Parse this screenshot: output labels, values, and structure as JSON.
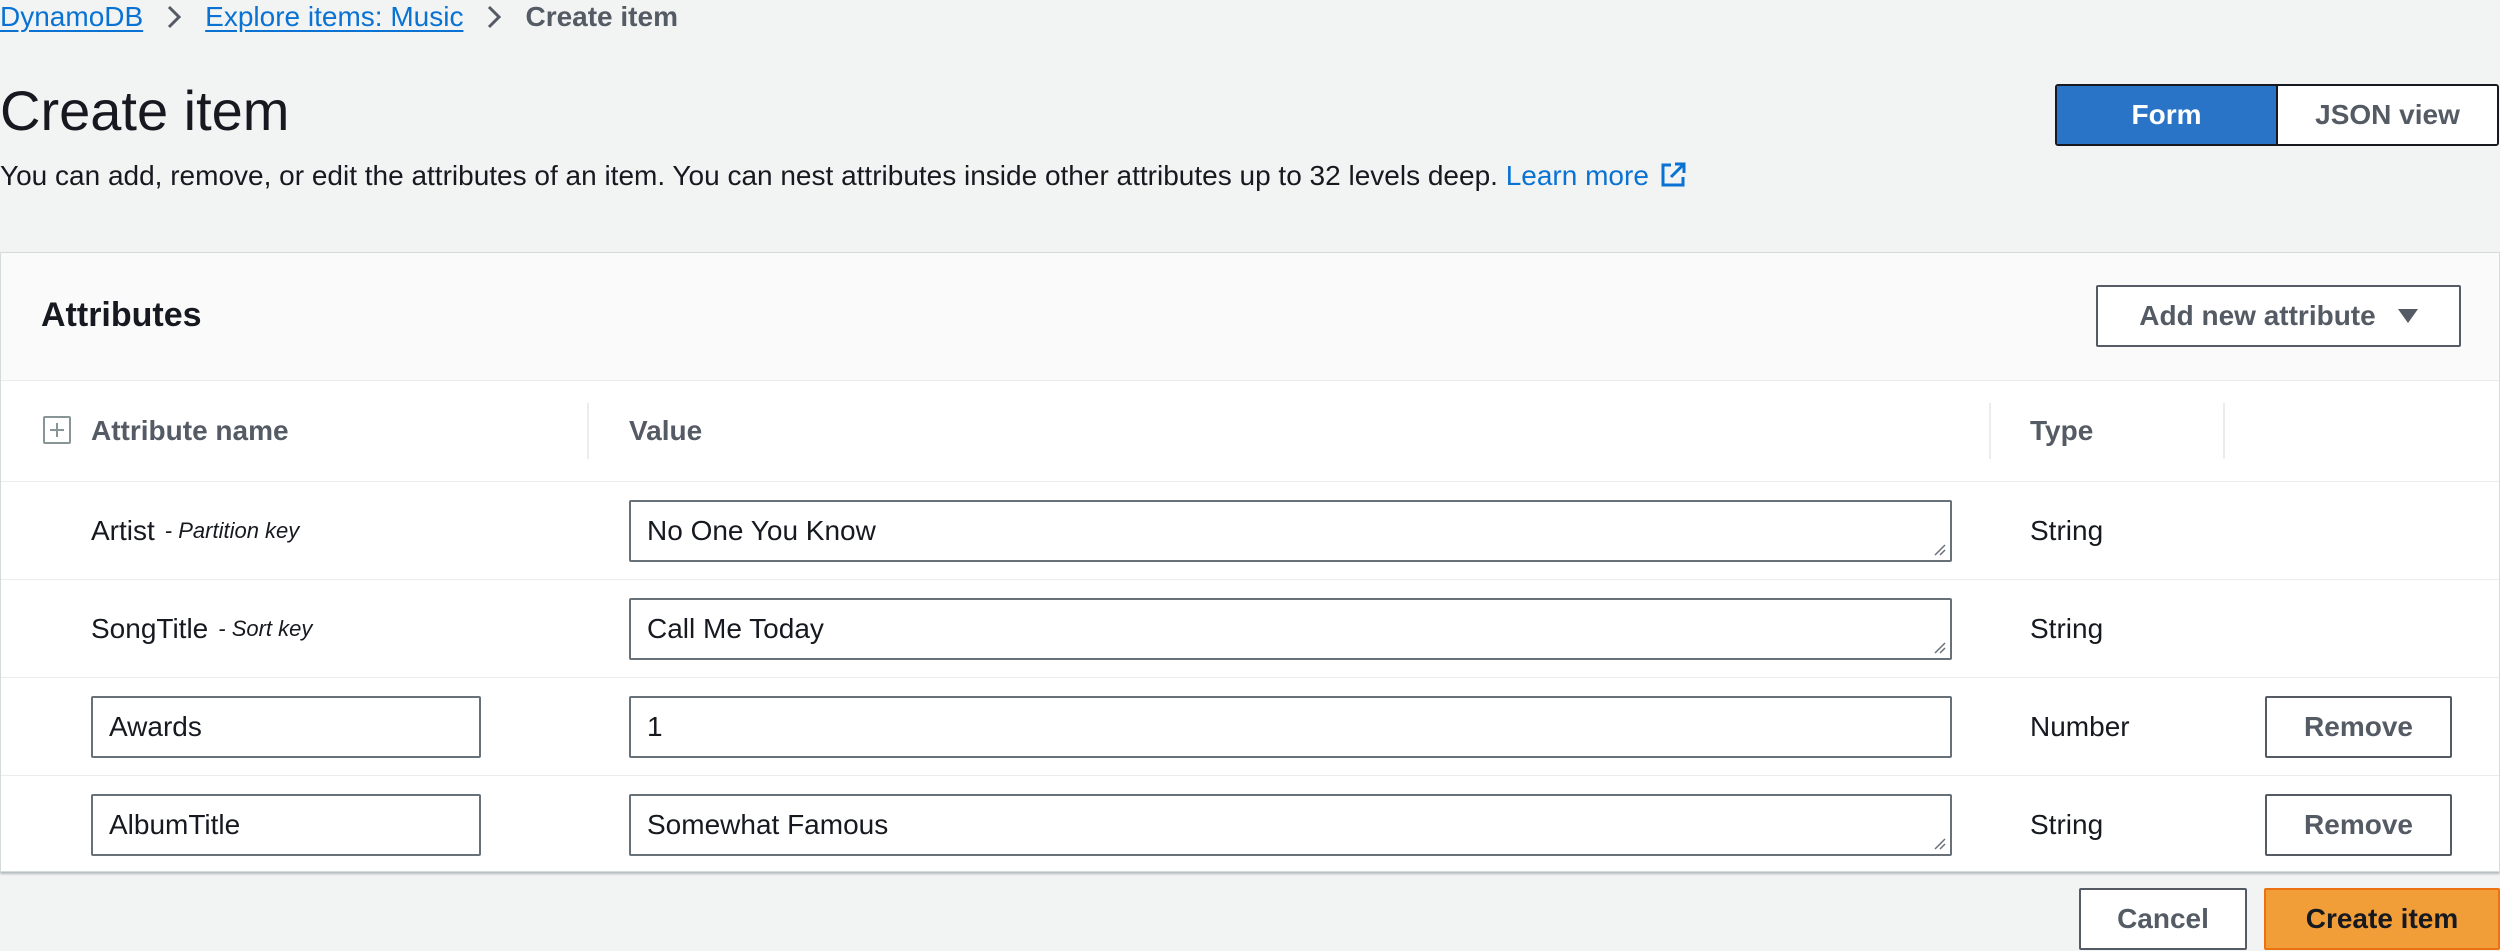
{
  "breadcrumb": {
    "items": [
      {
        "label": "DynamoDB",
        "link": true
      },
      {
        "label": "Explore items: Music",
        "link": true
      },
      {
        "label": "Create item",
        "link": false
      }
    ]
  },
  "header": {
    "title": "Create item",
    "description": "You can add, remove, or edit the attributes of an item. You can nest attributes inside other attributes up to 32 levels deep.",
    "learn_more": "Learn more",
    "external_icon": "external-link-icon"
  },
  "view_toggle": {
    "options": [
      {
        "label": "Form",
        "selected": true
      },
      {
        "label": "JSON view",
        "selected": false
      }
    ]
  },
  "attributes": {
    "title": "Attributes",
    "add_button_label": "Add new attribute",
    "columns": {
      "name": "Attribute name",
      "value": "Value",
      "type": "Type"
    },
    "rows": [
      {
        "name": "Artist",
        "key_label": "- Partition key",
        "value": "No One You Know",
        "type": "String",
        "editable_name": false,
        "removable": false
      },
      {
        "name": "SongTitle",
        "key_label": "- Sort key",
        "value": "Call Me Today",
        "type": "String",
        "editable_name": false,
        "removable": false
      },
      {
        "name": "Awards",
        "key_label": "",
        "value": "1",
        "type": "Number",
        "editable_name": true,
        "removable": true
      },
      {
        "name": "AlbumTitle",
        "key_label": "",
        "value": "Somewhat Famous",
        "type": "String",
        "editable_name": true,
        "removable": true
      }
    ],
    "remove_label": "Remove"
  },
  "footer": {
    "cancel_label": "Cancel",
    "create_label": "Create item"
  },
  "colors": {
    "primary_blue": "#2a74c7",
    "link_blue": "#0972d3",
    "action_orange": "#f19d38",
    "background": "#f2f3f3"
  }
}
